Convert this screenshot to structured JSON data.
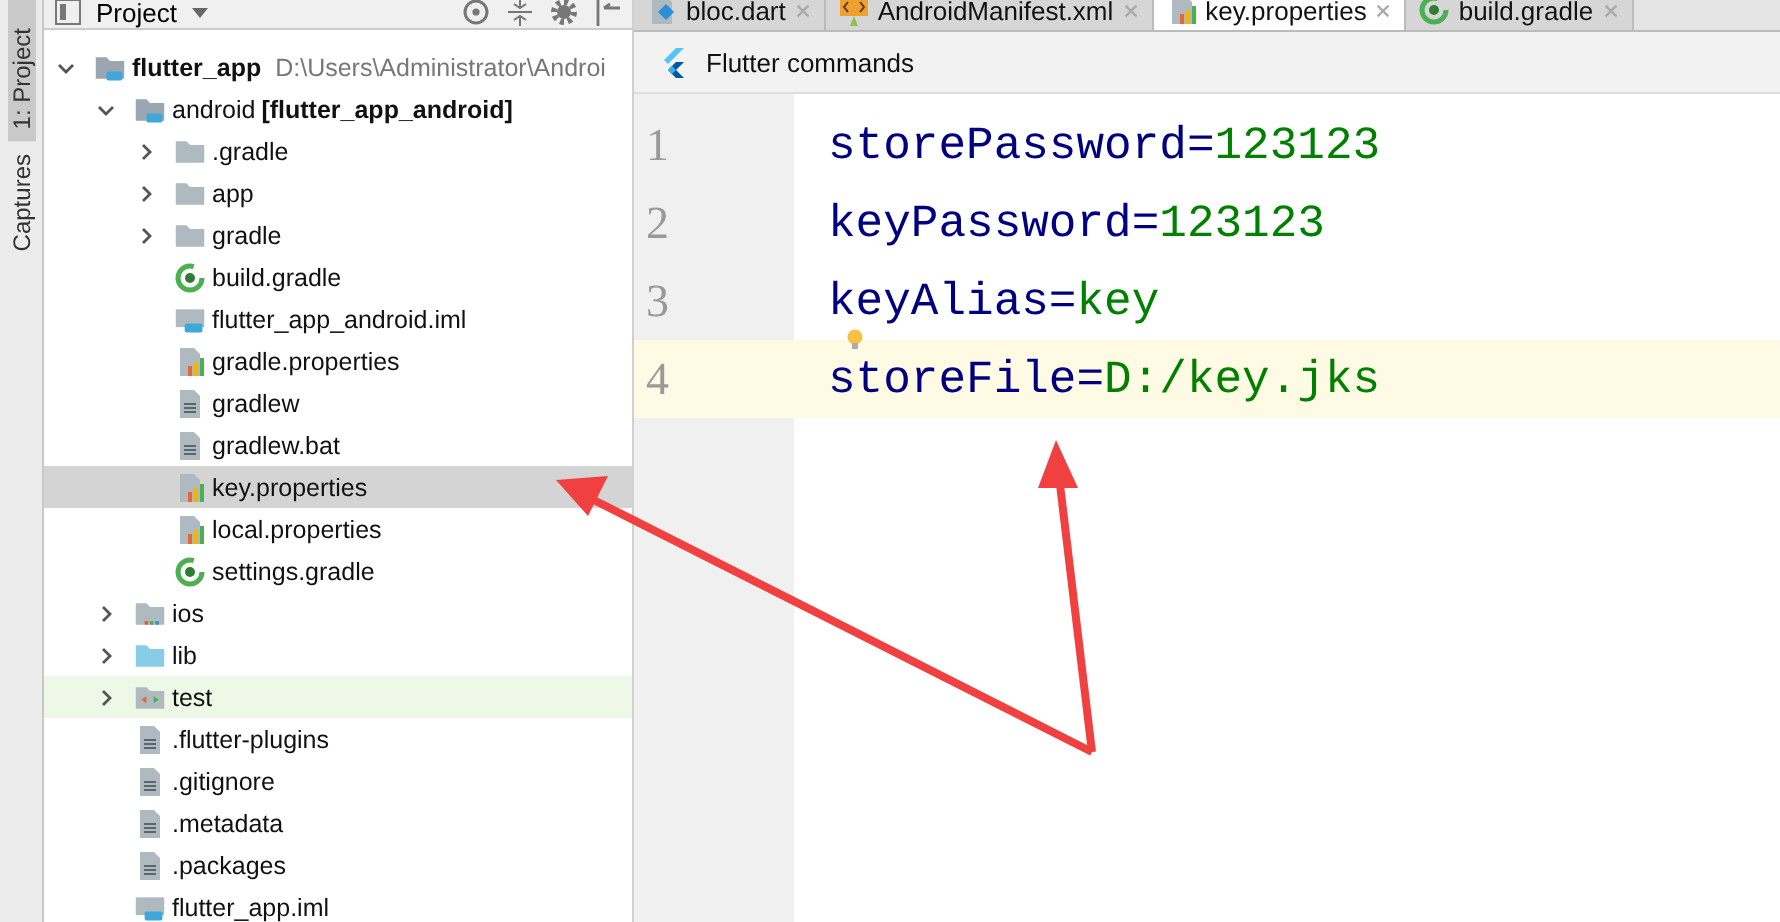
{
  "side_strip": {
    "tabs": [
      {
        "label": "1: Project",
        "selected": true
      },
      {
        "label": "Captures",
        "selected": false
      }
    ]
  },
  "project_panel": {
    "title": "Project",
    "tree": [
      {
        "name": "flutter_app",
        "kind": "module",
        "path": "D:\\Users\\Administrator\\Androi",
        "expanded": true,
        "selected": false,
        "children": [
          {
            "name": "android",
            "kind": "module",
            "module": "[flutter_app_android]",
            "expanded": true,
            "selected": false,
            "children": [
              {
                "name": ".gradle",
                "kind": "folder",
                "expanded": false,
                "selected": false
              },
              {
                "name": "app",
                "kind": "folder",
                "expanded": false,
                "selected": false
              },
              {
                "name": "gradle",
                "kind": "folder",
                "expanded": false,
                "selected": false
              },
              {
                "name": "build.gradle",
                "kind": "gradle",
                "selected": false
              },
              {
                "name": "flutter_app_android.iml",
                "kind": "iml",
                "selected": false
              },
              {
                "name": "gradle.properties",
                "kind": "properties",
                "selected": false
              },
              {
                "name": "gradlew",
                "kind": "text",
                "selected": false
              },
              {
                "name": "gradlew.bat",
                "kind": "text",
                "selected": false
              },
              {
                "name": "key.properties",
                "kind": "properties",
                "selected": true
              },
              {
                "name": "local.properties",
                "kind": "properties",
                "selected": false
              },
              {
                "name": "settings.gradle",
                "kind": "gradle",
                "selected": false
              }
            ]
          },
          {
            "name": "ios",
            "kind": "ios",
            "expanded": false,
            "selected": false
          },
          {
            "name": "lib",
            "kind": "source",
            "expanded": false,
            "selected": false
          },
          {
            "name": "test",
            "kind": "test",
            "expanded": false,
            "selected": false
          },
          {
            "name": ".flutter-plugins",
            "kind": "text",
            "selected": false
          },
          {
            "name": ".gitignore",
            "kind": "text",
            "selected": false
          },
          {
            "name": ".metadata",
            "kind": "text",
            "selected": false
          },
          {
            "name": ".packages",
            "kind": "text",
            "selected": false
          },
          {
            "name": "flutter_app.iml",
            "kind": "iml",
            "selected": false
          }
        ]
      }
    ]
  },
  "editor": {
    "tabs": [
      {
        "label": "bloc.dart",
        "kind": "dart",
        "selected": false
      },
      {
        "label": "AndroidManifest.xml",
        "kind": "xml",
        "selected": false
      },
      {
        "label": "key.properties",
        "kind": "properties",
        "selected": true
      },
      {
        "label": "build.gradle",
        "kind": "gradle",
        "selected": false
      }
    ],
    "toolbar": "Flutter commands",
    "lines": [
      {
        "number": "1",
        "key": "storePassword",
        "sep": "=",
        "value": "123123",
        "current": false
      },
      {
        "number": "2",
        "key": "keyPassword",
        "sep": "=",
        "value": "123123",
        "current": false
      },
      {
        "number": "3",
        "key": "keyAlias",
        "sep": "=",
        "value": "key",
        "current": false,
        "bulb": true
      },
      {
        "number": "4",
        "key": "storeFile",
        "sep": "=",
        "value": "D:/key.jks",
        "current": true
      }
    ]
  }
}
